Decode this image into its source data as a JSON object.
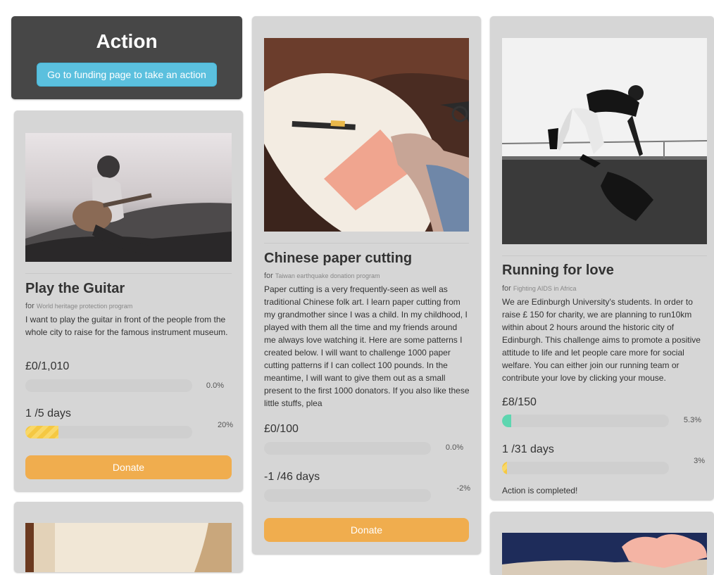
{
  "action": {
    "title": "Action",
    "button_label": "Go to funding page to take an action"
  },
  "cards": [
    {
      "title": "Play the Guitar",
      "for_label": "for",
      "program": "World heritage protection program",
      "description": "I want to play the guitar in front of the people from the whole city to raise for the famous instrument museum.",
      "money": "£0/1,010",
      "money_pct": "0.0%",
      "money_fill": 0,
      "days": "1 /5 days",
      "days_pct": "20%",
      "days_fill": 0.2,
      "button_label": "Donate"
    },
    {
      "title": "Chinese paper cutting",
      "for_label": "for",
      "program": "Taiwan earthquake donation program",
      "description": "Paper cutting is a very frequently-seen as well as traditional Chinese folk art. I learn paper cutting from my grandmother since I was a child. In my childhood, I played with them all the time and my friends around me always love watching it. Here are some patterns I created below. I will want to challenge 1000 paper cutting patterns if I can collect 100 pounds. In the meantime, I will want to give them out as a small present to the first 1000 donators. If you also like these little stuffs, plea",
      "money": "£0/100",
      "money_pct": "0.0%",
      "money_fill": 0,
      "days": "-1 /46 days",
      "days_pct": "-2%",
      "days_fill": 0,
      "button_label": "Donate"
    },
    {
      "title": "Running for love",
      "for_label": "for",
      "program": "Fighting AIDS in Africa",
      "description": "We are Edinburgh University's students. In order to raise £ 150 for charity, we are planning to run10km within about 2 hours around the historic city of Edinburgh. This challenge aims to promote a positive attitude to life and let people care more for social welfare. You can either join our running team or contribute your love by clicking your mouse.",
      "money": "£8/150",
      "money_pct": "5.3%",
      "money_fill": 0.053,
      "days": "1 /31 days",
      "days_pct": "3%",
      "days_fill": 0.03,
      "status": "Action is completed!"
    }
  ],
  "colors": {
    "money_fill": "#5ed6b0",
    "days_fill": "#f5c842",
    "donate": "#f0ad4e",
    "action_button": "#5bc0de",
    "card_bg": "#d6d6d6",
    "action_bg": "#474747"
  }
}
